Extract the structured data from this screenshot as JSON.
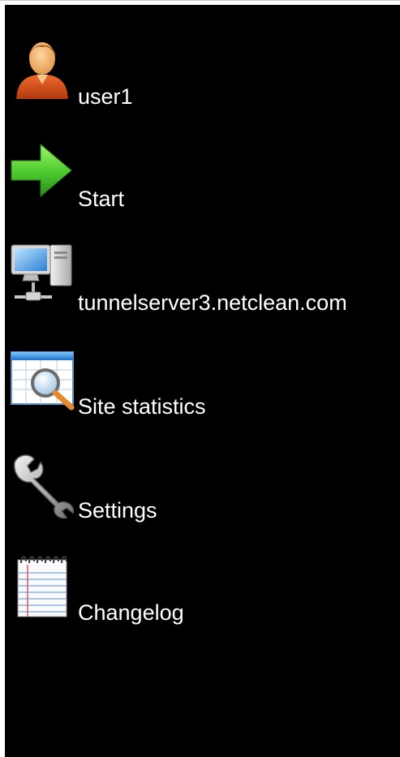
{
  "menu": {
    "items": [
      {
        "label": "user1",
        "icon": "user-icon"
      },
      {
        "label": "Start",
        "icon": "arrow-right-icon"
      },
      {
        "label": "tunnelserver3.netclean.com",
        "icon": "computer-network-icon"
      },
      {
        "label": "Site statistics",
        "icon": "statistics-search-icon"
      },
      {
        "label": "Settings",
        "icon": "wrench-icon"
      },
      {
        "label": "Changelog",
        "icon": "notepad-icon"
      }
    ]
  },
  "colors": {
    "background": "#000000",
    "text": "#ffffff",
    "arrow": "#4cc92e",
    "user_shirt": "#d9541e"
  }
}
